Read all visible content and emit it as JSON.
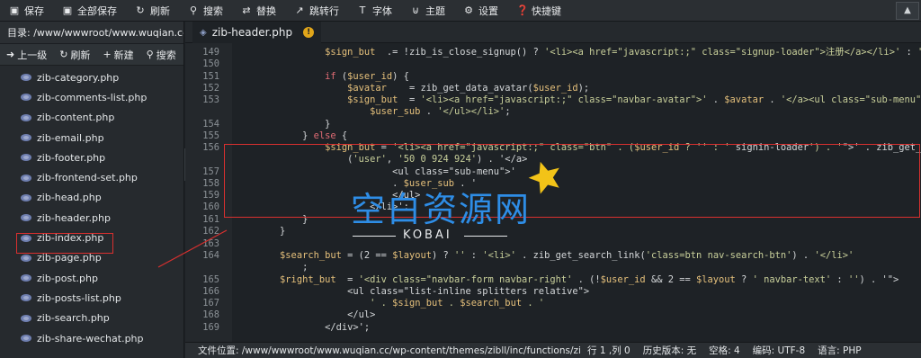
{
  "toolbar": {
    "items": [
      {
        "label": "保存",
        "icon": "save-icon"
      },
      {
        "label": "全部保存",
        "icon": "save-all-icon"
      },
      {
        "label": "刷新",
        "icon": "refresh-icon"
      },
      {
        "label": "搜索",
        "icon": "search-icon"
      },
      {
        "label": "替换",
        "icon": "replace-icon"
      },
      {
        "label": "跳转行",
        "icon": "goto-line-icon"
      },
      {
        "label": "字体",
        "icon": "font-icon"
      },
      {
        "label": "主题",
        "icon": "theme-icon"
      },
      {
        "label": "设置",
        "icon": "gear-icon"
      },
      {
        "label": "快捷键",
        "icon": "help-icon"
      }
    ],
    "collapse_icon": "collapse-up-icon"
  },
  "sidebar": {
    "directory": "目录: /www/wwwroot/www.wuqian.cc...",
    "tools": [
      {
        "label": "上一级",
        "icon": "up-level-icon"
      },
      {
        "label": "刷新",
        "icon": "refresh-icon"
      },
      {
        "label": "新建",
        "icon": "plus-icon"
      },
      {
        "label": "搜索",
        "icon": "search-icon"
      }
    ],
    "files": [
      "zib-category.php",
      "zib-comments-list.php",
      "zib-content.php",
      "zib-email.php",
      "zib-footer.php",
      "zib-frontend-set.php",
      "zib-head.php",
      "zib-header.php",
      "zib-index.php",
      "zib-page.php",
      "zib-post.php",
      "zib-posts-list.php",
      "zib-search.php",
      "zib-share-wechat.php"
    ],
    "selected_file": "zib-header.php"
  },
  "tab": {
    "label": "zib-header.php",
    "modified_badge": "!"
  },
  "editor": {
    "lines": [
      {
        "n": "149",
        "text": "                $sign_but  .= !zib_is_close_signup() ? '<li><a href=\"javascript:;\" class=\"signup-loader\">注册</a></li>' : '';"
      },
      {
        "n": "150",
        "text": ""
      },
      {
        "n": "151",
        "text": "                if ($user_id) {"
      },
      {
        "n": "152",
        "text": "                    $avatar    = zib_get_data_avatar($user_id);"
      },
      {
        "n": "153",
        "text": "                    $sign_but  = '<li><a href=\"javascript:;\" class=\"navbar-avatar\">' . $avatar . '</a><ul class=\"sub-menu\">' ."
      },
      {
        "n": "",
        "text": "                        $user_sub . '</ul></li>';"
      },
      {
        "n": "154",
        "text": "                }"
      },
      {
        "n": "155",
        "text": "            } else {"
      },
      {
        "n": "156",
        "text": "                $sign_but = '<li><a href=\"javascript:;\" class=\"btn\" . ($user_id ? '' : ' signin-loader') . '\">' . zib_get_svg"
      },
      {
        "n": "",
        "text": "                    ('user', '50 0 924 924') . '</a>"
      },
      {
        "n": "157",
        "text": "                            <ul class=\"sub-menu\">'"
      },
      {
        "n": "158",
        "text": "                            . $user_sub . '"
      },
      {
        "n": "159",
        "text": "                            </ul>"
      },
      {
        "n": "160",
        "text": "                        </li>';"
      },
      {
        "n": "161",
        "text": "            }"
      },
      {
        "n": "162",
        "text": "        }"
      },
      {
        "n": "163",
        "text": ""
      },
      {
        "n": "164",
        "text": "        $search_but = (2 == $layout) ? '' : '<li>' . zib_get_search_link('class=btn nav-search-btn') . '</li>'"
      },
      {
        "n": "",
        "text": "            ;"
      },
      {
        "n": "165",
        "text": "        $right_but  = '<div class=\"navbar-form navbar-right' . (!$user_id && 2 == $layout ? ' navbar-text' : '') . '\">"
      },
      {
        "n": "166",
        "text": "                    <ul class=\"list-inline splitters relative\">"
      },
      {
        "n": "167",
        "text": "                        ' . $sign_but . $search_but . '"
      },
      {
        "n": "168",
        "text": "                    </ul>"
      },
      {
        "n": "169",
        "text": "                </div>';"
      }
    ]
  },
  "watermark": {
    "title": "空白资源网",
    "subtitle": "KOBAI"
  },
  "statusbar": {
    "path": "文件位置: /www/wwwroot/www.wuqian.cc/wp-content/themes/zibll/inc/functions/zib",
    "cursor": "行 1 ,列 0",
    "history": "历史版本: 无",
    "indent": "空格: 4",
    "encoding": "编码: UTF-8",
    "language": "语言: PHP"
  },
  "colors": {
    "highlight_border": "#d9302f",
    "watermark_blue": "#2e8de6",
    "star_yellow": "#f2c318"
  }
}
